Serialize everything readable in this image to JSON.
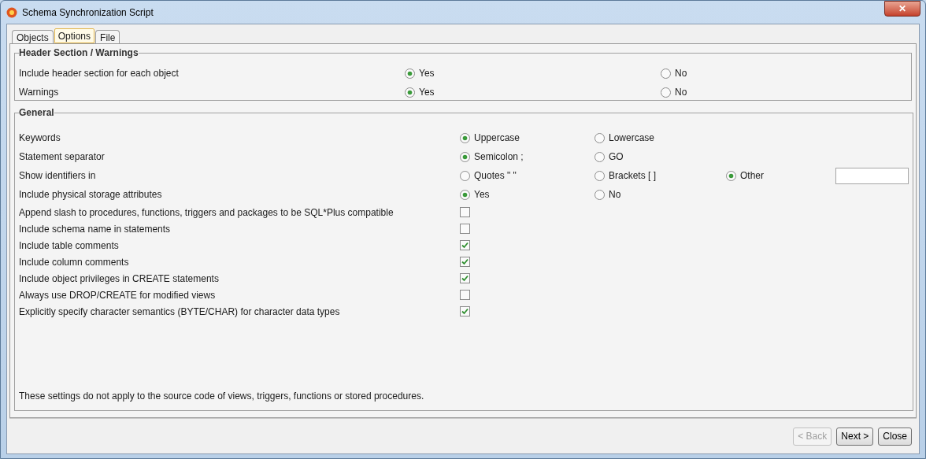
{
  "window": {
    "title": "Schema Synchronization Script",
    "close": "✕"
  },
  "tabs": [
    {
      "label": "Objects",
      "selected": false
    },
    {
      "label": "Options",
      "selected": true
    },
    {
      "label": "File",
      "selected": false
    }
  ],
  "groups": [
    {
      "title": "Header Section / Warnings",
      "rows": [
        {
          "kind": "radio",
          "label": "Include header section for each object",
          "options": [
            {
              "label": "Yes",
              "selected": true
            },
            {
              "label": "No",
              "selected": false
            }
          ]
        },
        {
          "kind": "radio",
          "label": "Warnings",
          "options": [
            {
              "label": "Yes",
              "selected": true
            },
            {
              "label": "No",
              "selected": false
            }
          ]
        }
      ]
    },
    {
      "title": "General",
      "rows": [
        {
          "kind": "radio",
          "label": "Keywords",
          "options": [
            {
              "label": "Uppercase",
              "selected": true
            },
            {
              "label": "Lowercase",
              "selected": false
            }
          ]
        },
        {
          "kind": "radio",
          "label": "Statement separator",
          "options": [
            {
              "label": "Semicolon ;",
              "selected": true
            },
            {
              "label": "GO",
              "selected": false
            }
          ]
        },
        {
          "kind": "radio",
          "label": "Show identifiers in",
          "options": [
            {
              "label": "Quotes \" \"",
              "selected": false
            },
            {
              "label": "Brackets [ ]",
              "selected": false
            },
            {
              "label": "Other",
              "selected": true
            }
          ],
          "field": true
        },
        {
          "kind": "radio",
          "label": "Include physical storage attributes",
          "options": [
            {
              "label": "Yes",
              "selected": true
            },
            {
              "label": "No",
              "selected": false
            }
          ]
        },
        {
          "kind": "checkbox",
          "label": "Append slash to procedures, functions, triggers and packages to be SQL*Plus compatible",
          "checked": false
        },
        {
          "kind": "checkbox",
          "label": "Include schema name in statements",
          "checked": false
        },
        {
          "kind": "checkbox",
          "label": "Include table comments",
          "checked": true
        },
        {
          "kind": "checkbox",
          "label": "Include column comments",
          "checked": true
        },
        {
          "kind": "checkbox",
          "label": "Include object privileges in CREATE statements",
          "checked": true
        },
        {
          "kind": "checkbox",
          "label": "Always use DROP/CREATE for modified views",
          "checked": false
        },
        {
          "kind": "checkbox",
          "label": "Explicitly specify character semantics (BYTE/CHAR) for character data types",
          "checked": true
        }
      ],
      "note": "These settings do not apply to the source code of views, triggers, functions or stored procedures."
    }
  ],
  "buttons": [
    {
      "label": "< Back",
      "disabled": true
    },
    {
      "label": "Next >",
      "disabled": false
    },
    {
      "label": "Close",
      "disabled": false
    }
  ]
}
